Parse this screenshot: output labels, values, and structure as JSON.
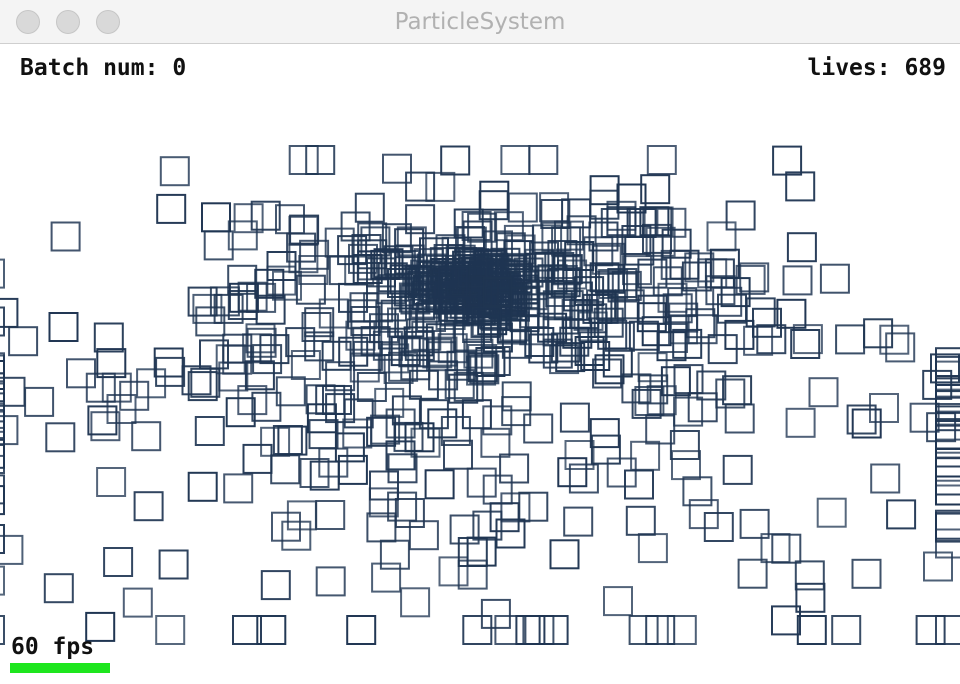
{
  "window": {
    "title": "ParticleSystem"
  },
  "hud": {
    "batch_label": "Batch num: 0",
    "lives_label": "lives: 689",
    "fps_label": "60 fps",
    "fps_bar_color": "#1ee61e"
  },
  "particles": {
    "stroke_color": "#1f3552",
    "shape": "square-outline",
    "count_drawn": 689
  }
}
